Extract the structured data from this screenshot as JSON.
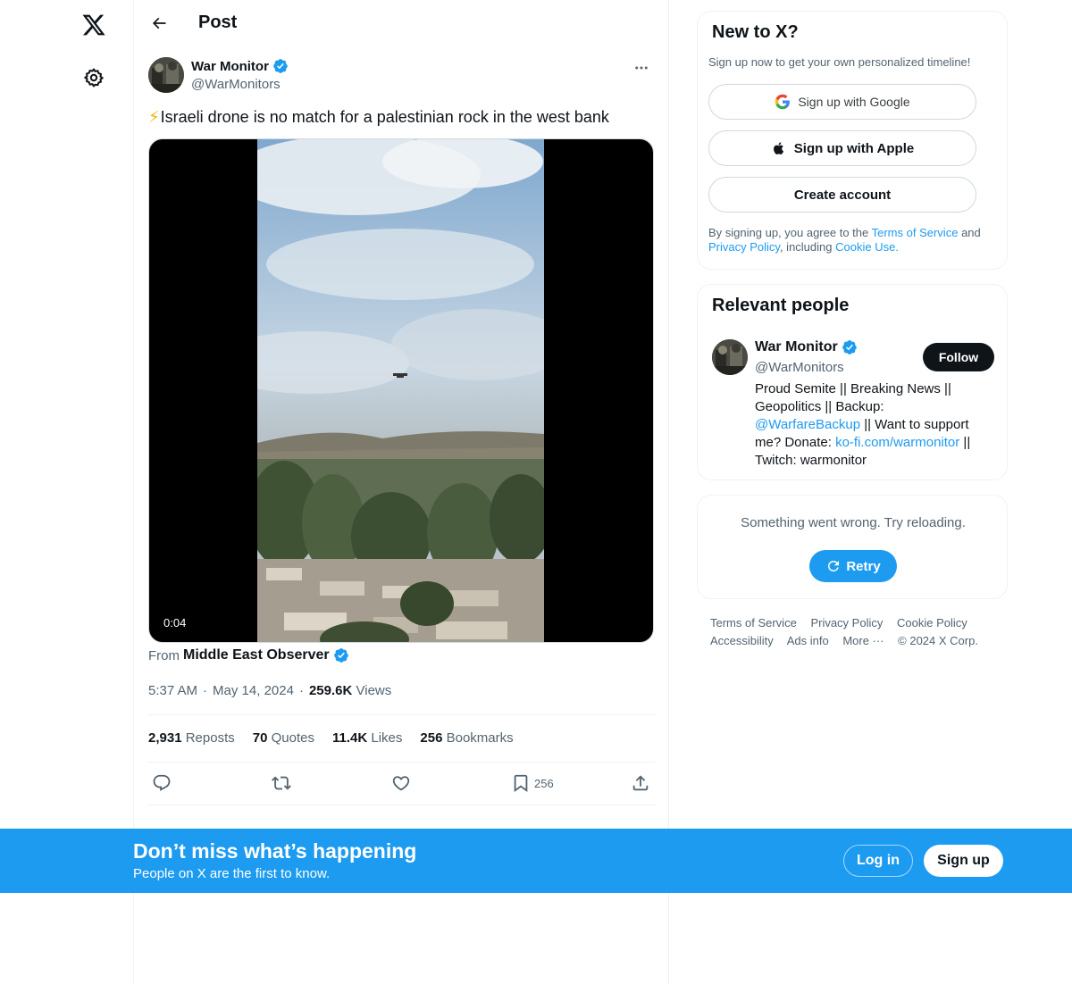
{
  "header": {
    "title": "Post"
  },
  "tweet": {
    "author_name": "War Monitor",
    "author_handle": "@WarMonitors",
    "emoji": "⚡",
    "text": "Israeli drone is no match for a palestinian rock in the west bank",
    "video_duration": "0:04",
    "from_label": "From",
    "from_source": "Middle East Observer",
    "time": "5:37 AM",
    "date": "May 14, 2024",
    "separator": "·",
    "views_count": "259.6K",
    "views_label": "Views",
    "stats": {
      "reposts_count": "2,931",
      "reposts_label": "Reposts",
      "quotes_count": "70",
      "quotes_label": "Quotes",
      "likes_count": "11.4K",
      "likes_label": "Likes",
      "bookmarks_count": "256",
      "bookmarks_label": "Bookmarks"
    },
    "actions": {
      "bookmark_count": "256"
    }
  },
  "signup_card": {
    "title": "New to X?",
    "subtitle": "Sign up now to get your own personalized timeline!",
    "google_label": "Sign up with Google",
    "apple_label": "Sign up with Apple",
    "create_label": "Create account",
    "legal_prefix": "By signing up, you agree to the",
    "terms_link": "Terms of Service",
    "legal_and": "and",
    "privacy_link": "Privacy Policy",
    "legal_including": ", including",
    "cookie_link": "Cookie Use."
  },
  "relevant_people": {
    "title": "Relevant people",
    "name": "War Monitor",
    "handle": "@WarMonitors",
    "follow_label": "Follow",
    "bio_1": "Proud Semite || Breaking News || Geopolitics || Backup: ",
    "bio_link_1": "@WarfareBackup",
    "bio_2": " || Want to support me? Donate: ",
    "bio_link_2": "ko-fi.com/warmonitor",
    "bio_3": " || Twitch: warmonitor"
  },
  "trends_error": {
    "message": "Something went wrong. Try reloading.",
    "retry_label": "Retry"
  },
  "footer": {
    "links": [
      "Terms of Service",
      "Privacy Policy",
      "Cookie Policy",
      "Accessibility",
      "Ads info",
      "More ···",
      "© 2024 X Corp."
    ]
  },
  "banner": {
    "title": "Don’t miss what’s happening",
    "subtitle": "People on X are the first to know.",
    "login_label": "Log in",
    "signup_label": "Sign up"
  },
  "colors": {
    "accent": "#1d9bf0",
    "text": "#0f1419",
    "secondary": "#536471",
    "border": "#eff3f4"
  },
  "icons": [
    "x-logo-icon",
    "settings-icon",
    "back-arrow-icon",
    "verified-badge-icon",
    "more-icon",
    "reply-icon",
    "repost-icon",
    "like-icon",
    "bookmark-icon",
    "share-icon",
    "google-icon",
    "apple-icon",
    "retry-icon"
  ]
}
